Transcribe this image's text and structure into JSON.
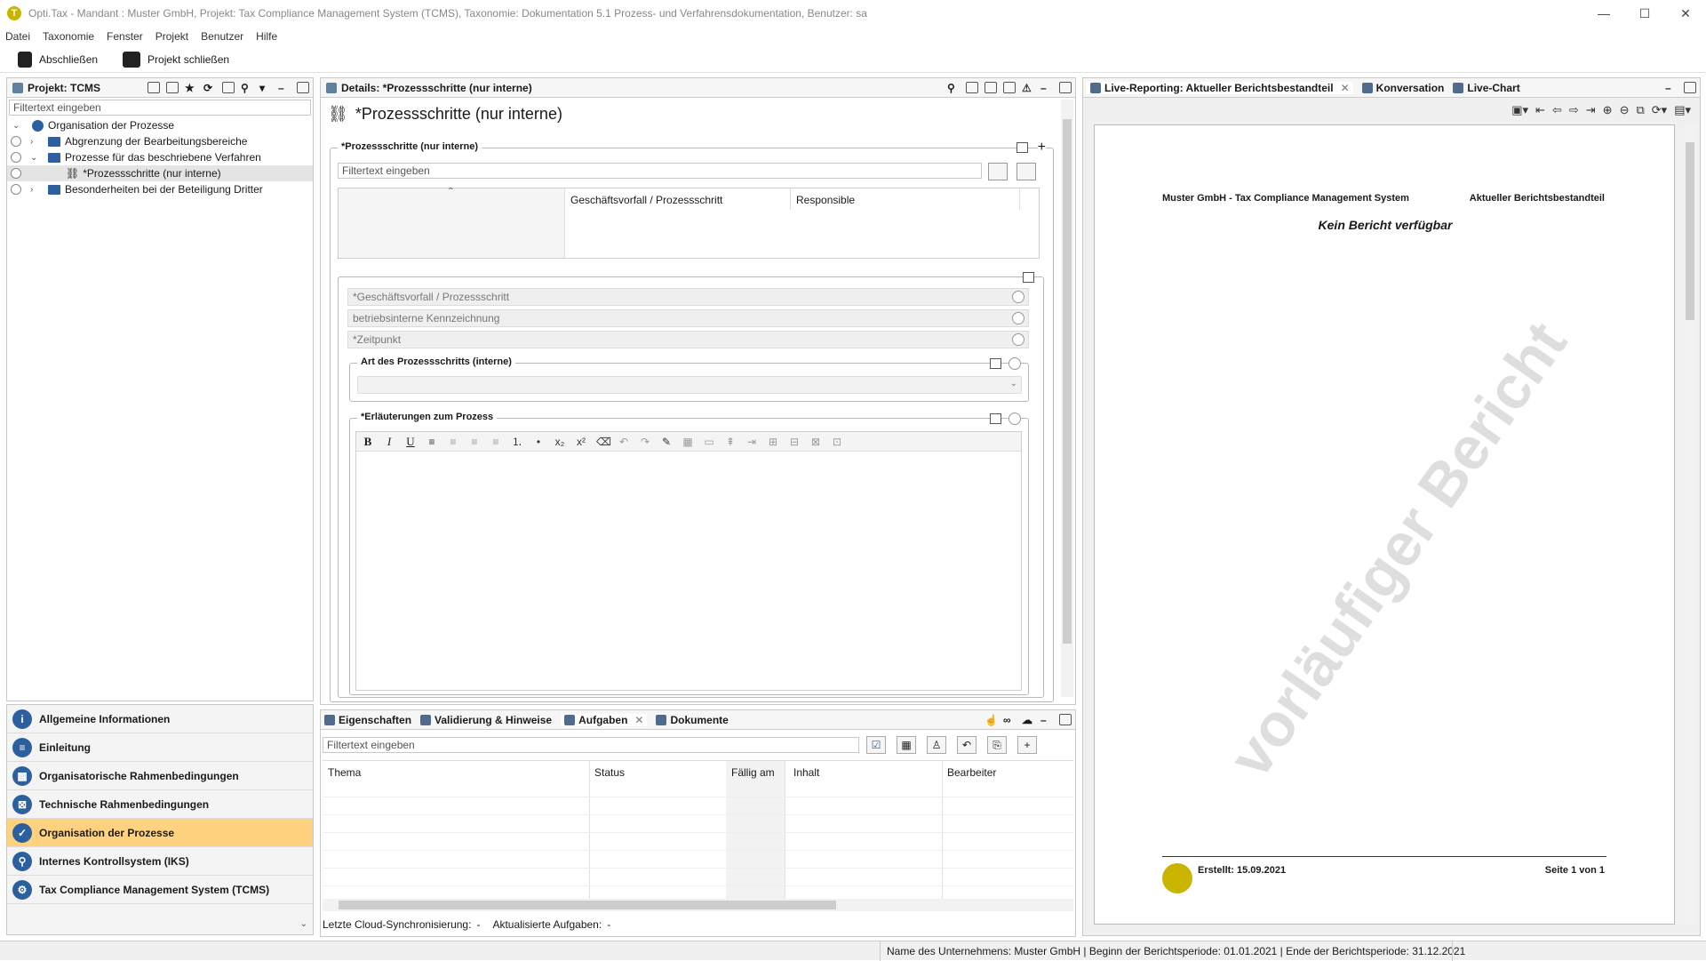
{
  "window": {
    "title": "Opti.Tax - Mandant : Muster GmbH, Projekt: Tax Compliance Management System (TCMS), Taxonomie: Dokumentation 5.1 Prozess- und Verfahrensdokumentation, Benutzer: sa",
    "logo_letter": "T"
  },
  "menu": [
    "Datei",
    "Taxonomie",
    "Fenster",
    "Projekt",
    "Benutzer",
    "Hilfe"
  ],
  "toolbar": {
    "lock_label": "Abschließen",
    "close_project_label": "Projekt schließen"
  },
  "left": {
    "tab_title": "Projekt: TCMS",
    "filter_placeholder": "Filtertext eingeben",
    "tree": [
      "Organisation der Prozesse",
      "Abgrenzung der Bearbeitungsbereiche",
      "Prozesse für das beschriebene Verfahren",
      "*Prozessschritte (nur interne)",
      "Besonderheiten bei der Beteiligung Dritter"
    ],
    "nav": [
      "Allgemeine Informationen",
      "Einleitung",
      "Organisatorische Rahmenbedingungen",
      "Technische Rahmenbedingungen",
      "Organisation der Prozesse",
      "Internes Kontrollsystem (IKS)",
      "Tax Compliance Management System (TCMS)"
    ]
  },
  "details": {
    "tab_title": "Details: *Prozessschritte (nur interne)",
    "heading": "*Prozessschritte (nur interne)",
    "group_label": "*Prozessschritte (nur interne)",
    "filter_placeholder": "Filtertext eingeben",
    "columns": [
      "Geschäftsvorfall / Prozessschritt",
      "Responsible"
    ],
    "fields": [
      "*Geschäftsvorfall / Prozessschritt",
      "betriebsinterne Kennzeichnung",
      "*Zeitpunkt"
    ],
    "art_label": "Art des Prozessschritts (interne)",
    "erl_label": "*Erläuterungen zum Prozess"
  },
  "bottom": {
    "tabs": [
      "Eigenschaften",
      "Validierung & Hinweise",
      "Aufgaben",
      "Dokumente"
    ],
    "filter_placeholder": "Filtertext eingeben",
    "columns": [
      "Thema",
      "Status",
      "Fällig am",
      "Inhalt",
      "Bearbeiter"
    ],
    "sync_label": "Letzte Cloud-Synchronisierung:",
    "sync_value": "-",
    "updated_label": "Aktualisierte Aufgaben:",
    "updated_value": "-"
  },
  "right": {
    "tabs": [
      "Live-Reporting: Aktueller Berichtsbestandteil",
      "Konversation",
      "Live-Chart"
    ],
    "report_header_left": "Muster GmbH - Tax Compliance Management System",
    "report_header_right": "Aktueller Berichtsbestandteil",
    "report_message": "Kein Bericht verfügbar",
    "watermark": "vorläufiger Bericht",
    "created": "Erstellt: 15.09.2021",
    "page": "Seite 1 von 1"
  },
  "status": {
    "text": "Name des Unternehmens: Muster GmbH | Beginn der Berichtsperiode: 01.01.2021 | Ende der Berichtsperiode: 31.12.2021"
  },
  "colors": {
    "accent": "#2c5f9e",
    "active_nav": "#ffd280",
    "logo": "#c9b400"
  }
}
